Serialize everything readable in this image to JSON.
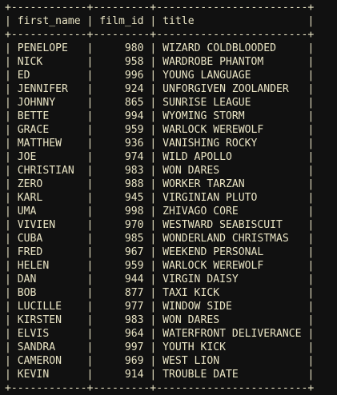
{
  "table": {
    "columns": [
      "first_name",
      "film_id",
      "title"
    ],
    "rows": [
      [
        "PENELOPE",
        "980",
        "WIZARD COLDBLOODED"
      ],
      [
        "NICK",
        "958",
        "WARDROBE PHANTOM"
      ],
      [
        "ED",
        "996",
        "YOUNG LANGUAGE"
      ],
      [
        "JENNIFER",
        "924",
        "UNFORGIVEN ZOOLANDER"
      ],
      [
        "JOHNNY",
        "865",
        "SUNRISE LEAGUE"
      ],
      [
        "BETTE",
        "994",
        "WYOMING STORM"
      ],
      [
        "GRACE",
        "959",
        "WARLOCK WEREWOLF"
      ],
      [
        "MATTHEW",
        "936",
        "VANISHING ROCKY"
      ],
      [
        "JOE",
        "974",
        "WILD APOLLO"
      ],
      [
        "CHRISTIAN",
        "983",
        "WON DARES"
      ],
      [
        "ZERO",
        "988",
        "WORKER TARZAN"
      ],
      [
        "KARL",
        "945",
        "VIRGINIAN PLUTO"
      ],
      [
        "UMA",
        "998",
        "ZHIVAGO CORE"
      ],
      [
        "VIVIEN",
        "970",
        "WESTWARD SEABISCUIT"
      ],
      [
        "CUBA",
        "985",
        "WONDERLAND CHRISTMAS"
      ],
      [
        "FRED",
        "967",
        "WEEKEND PERSONAL"
      ],
      [
        "HELEN",
        "959",
        "WARLOCK WEREWOLF"
      ],
      [
        "DAN",
        "944",
        "VIRGIN DAISY"
      ],
      [
        "BOB",
        "877",
        "TAXI KICK"
      ],
      [
        "LUCILLE",
        "977",
        "WINDOW SIDE"
      ],
      [
        "KIRSTEN",
        "983",
        "WON DARES"
      ],
      [
        "ELVIS",
        "964",
        "WATERFRONT DELIVERANCE"
      ],
      [
        "SANDRA",
        "997",
        "YOUTH KICK"
      ],
      [
        "CAMERON",
        "969",
        "WEST LION"
      ],
      [
        "KEVIN",
        "914",
        "TROUBLE DATE"
      ]
    ]
  },
  "colors": {
    "background": "#111111",
    "text": "#e9e4c4"
  }
}
